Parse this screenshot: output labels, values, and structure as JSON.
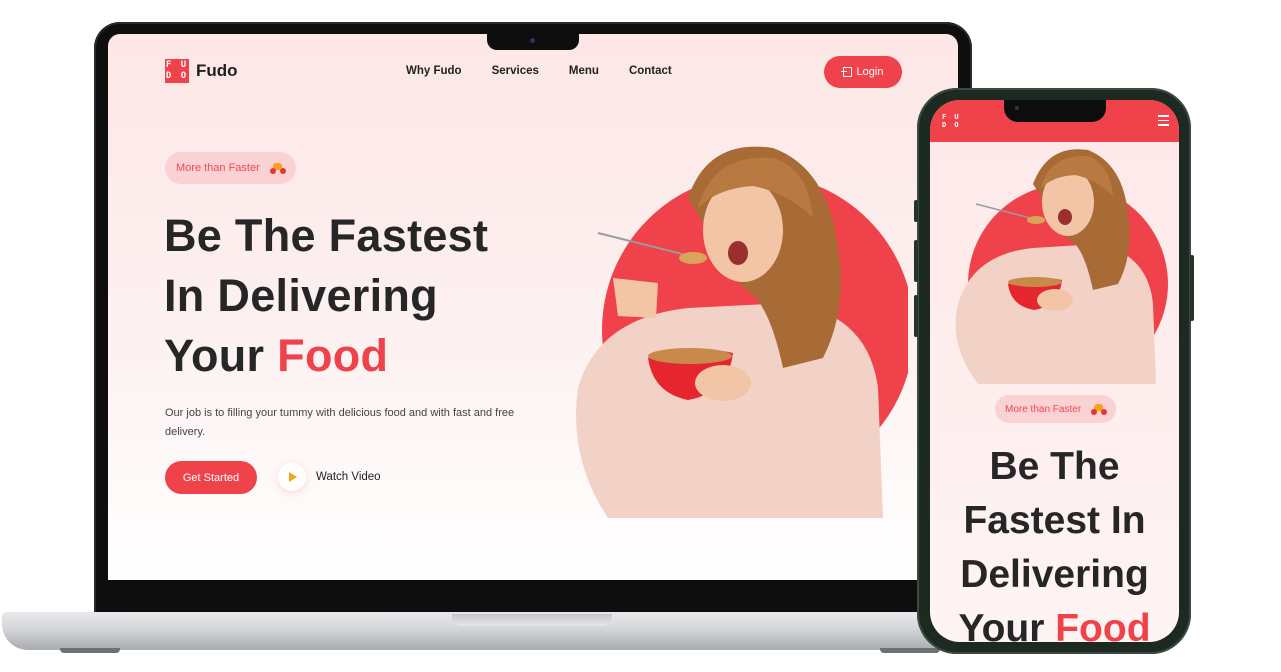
{
  "brand": {
    "logo_letters": "F U\nD O",
    "name": "Fudo",
    "accent_color": "#f0424b"
  },
  "nav": {
    "links": [
      "Why Fudo",
      "Services",
      "Menu",
      "Contact"
    ],
    "login_label": "Login"
  },
  "hero": {
    "badge": "More than Faster",
    "title_line1": "Be The Fastest",
    "title_line2": "In Delivering",
    "title_line3_prefix": "Your ",
    "title_accent": "Food",
    "description": "Our job is to filling your tummy with delicious food and with fast and free delivery.",
    "cta_label": "Get Started",
    "watch_label": "Watch Video"
  },
  "mobile": {
    "logo_letters": "F U\nD O",
    "badge": "More than Faster",
    "title_line1": "Be The",
    "title_line2": "Fastest In",
    "title_line3": "Delivering",
    "title_line4_prefix": "Your ",
    "title_accent": "Food"
  },
  "icons": [
    "login-icon",
    "scooter-icon",
    "play-icon",
    "menu-icon"
  ]
}
